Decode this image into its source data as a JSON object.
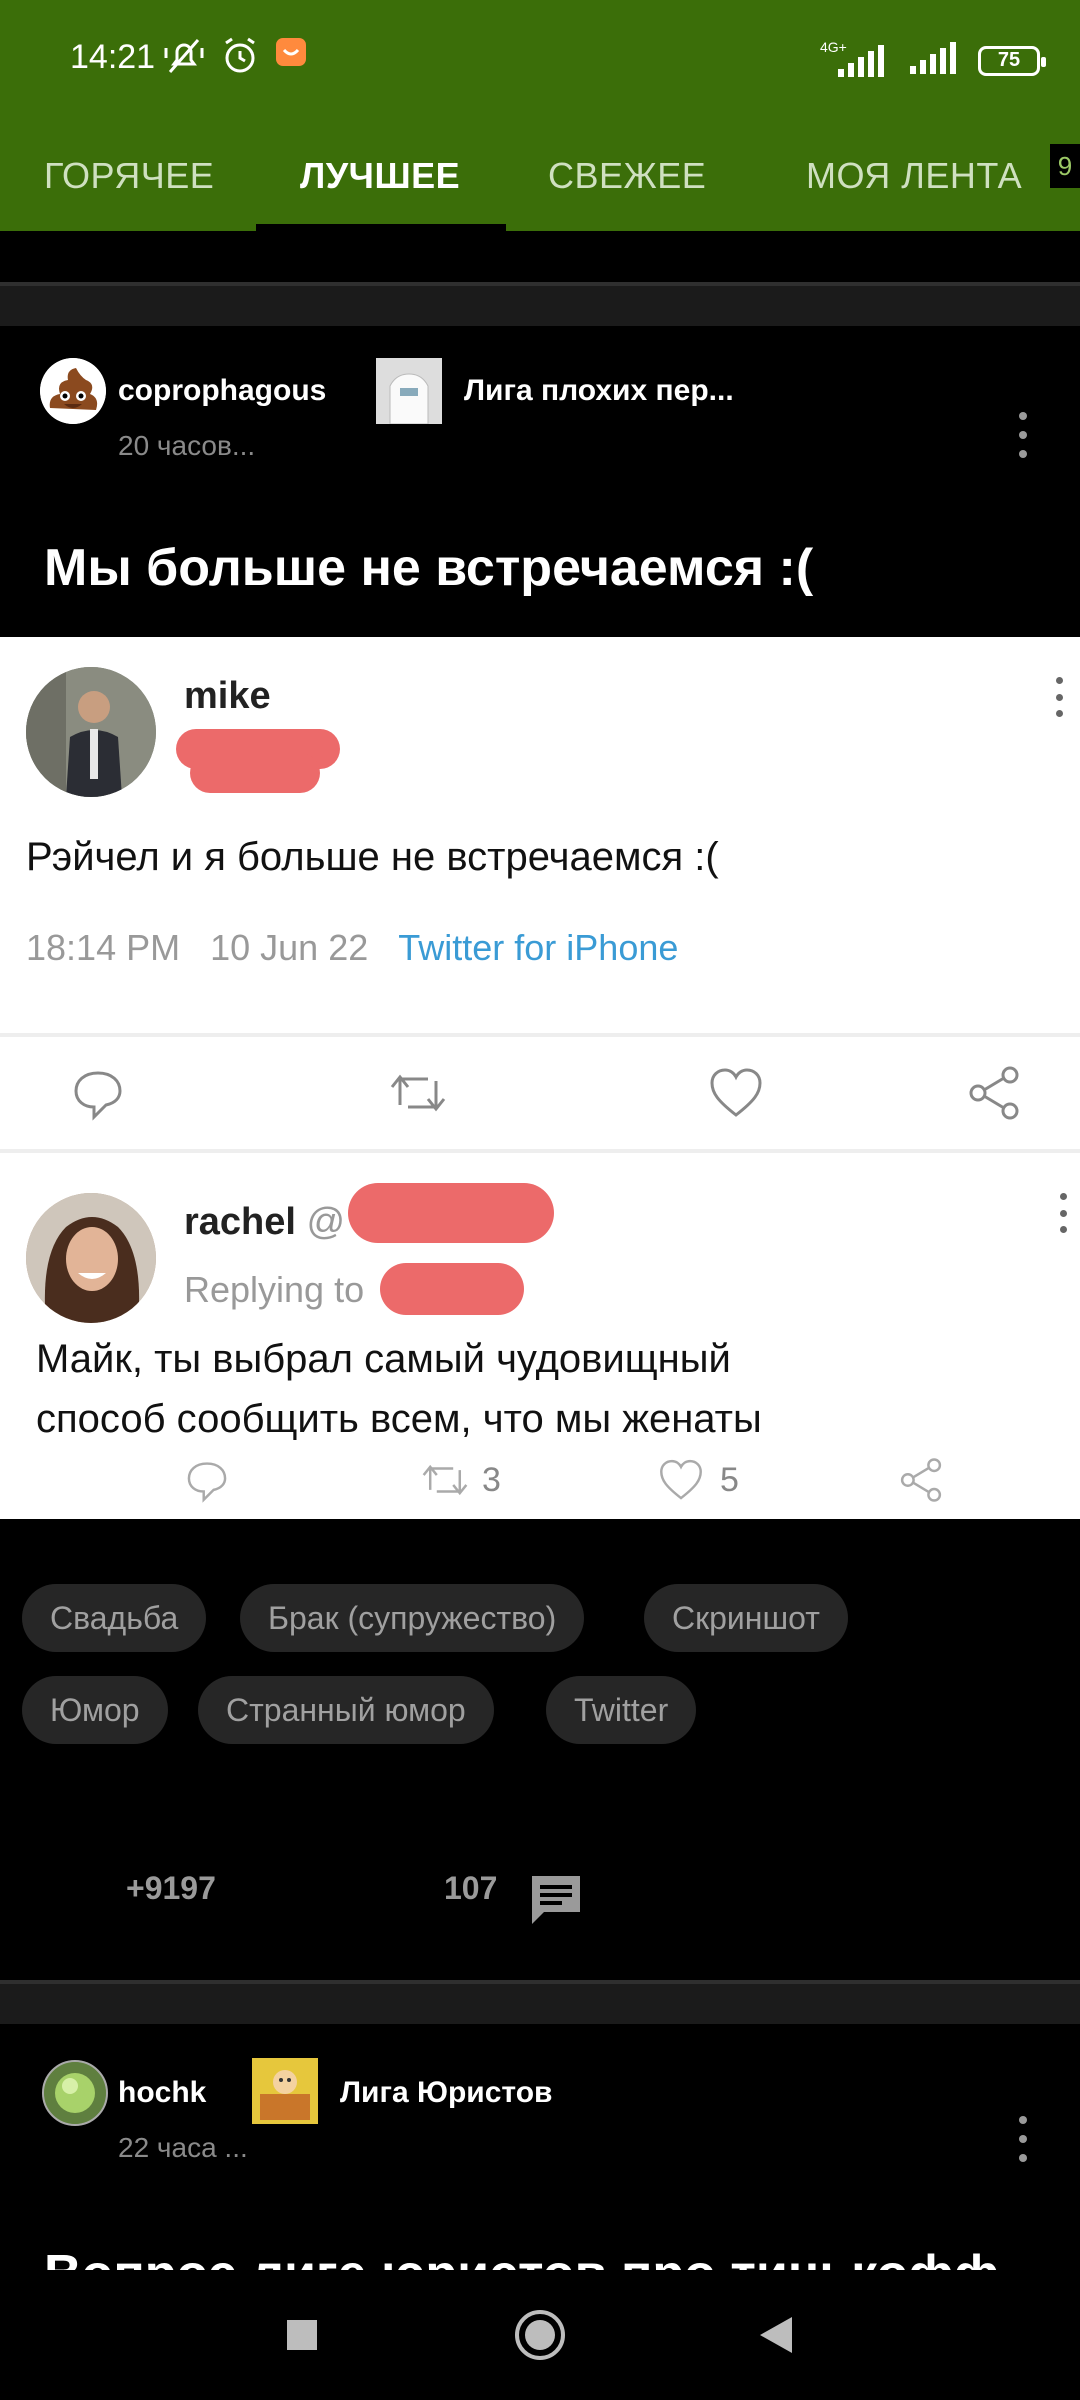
{
  "status_bar": {
    "time": "14:21",
    "network": "4G+",
    "battery": "75"
  },
  "tabs": [
    {
      "label": "ГОРЯЧЕЕ"
    },
    {
      "label": "ЛУЧШЕЕ",
      "active": true
    },
    {
      "label": "СВЕЖЕЕ"
    },
    {
      "label": "МОЯ ЛЕНТА"
    }
  ],
  "tab_badge": "9",
  "post1": {
    "author": "coprophagous",
    "time": "20 часов...",
    "community": "Лига плохих пер...",
    "title": "Мы больше не встречаемся :(",
    "tweet1": {
      "name": "mike",
      "text": "Рэйчел и я больше не встречаемся :(",
      "time": "18:14 PM",
      "date": "10 Jun 22",
      "source": "Twitter for iPhone"
    },
    "tweet2": {
      "name": "rachel",
      "at": "@",
      "replying": "Replying to",
      "text_line1": "Майк, ты выбрал самый чудовищный",
      "text_line2": "способ сообщить всем, что мы женаты",
      "retweets": "3",
      "likes": "5"
    },
    "tags": [
      "Свадьба",
      "Брак (супружество)",
      "Скриншот",
      "Юмор",
      "Странный юмор",
      "Twitter"
    ],
    "rating": "+9197",
    "comments": "107"
  },
  "post2": {
    "author": "hochk",
    "time": "22 часа ...",
    "community": "Лига Юристов",
    "title": "Вопрос лиге юристов про тинькофф"
  },
  "colors": {
    "accent_green": "#3b6e09",
    "redaction": "#ec6a6a",
    "twitter_source": "#3a9bd5"
  }
}
